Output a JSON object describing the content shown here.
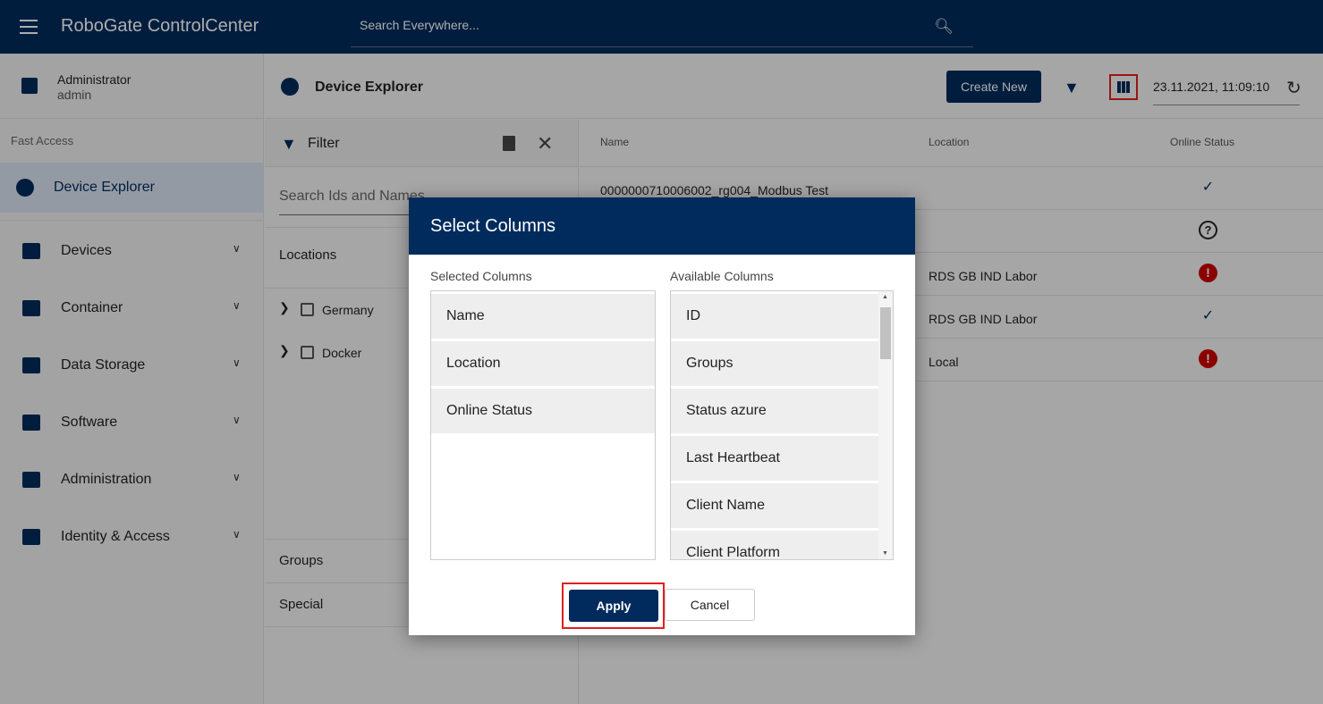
{
  "header": {
    "title": "RoboGate ControlCenter",
    "search_placeholder": "Search Everywhere..."
  },
  "sidebar": {
    "user_name": "Administrator",
    "user_login": "admin",
    "fast_access": "Fast Access",
    "active_item": "Device Explorer",
    "items": [
      {
        "label": "Devices"
      },
      {
        "label": "Container"
      },
      {
        "label": "Data Storage"
      },
      {
        "label": "Software"
      },
      {
        "label": "Administration"
      },
      {
        "label": "Identity & Access"
      }
    ]
  },
  "content": {
    "title": "Device Explorer",
    "create_new": "Create New",
    "timestamp": "23.11.2021, 11:09:10"
  },
  "filter": {
    "title": "Filter",
    "search_placeholder": "Search Ids and Names",
    "locations_label": "Locations",
    "locations": [
      {
        "label": "Germany"
      },
      {
        "label": "Docker"
      }
    ],
    "groups_label": "Groups",
    "special_label": "Special"
  },
  "table": {
    "headers": [
      "Name",
      "Location",
      "Online Status"
    ],
    "rows": [
      {
        "name": "0000000710006002_rg004_Modbus Test",
        "location": "",
        "status": "online"
      },
      {
        "name": "",
        "location": "",
        "status": "unknown"
      },
      {
        "name": "",
        "location": "RDS GB IND Labor",
        "status": "error"
      },
      {
        "name": "",
        "location": "RDS GB IND Labor",
        "status": "online"
      },
      {
        "name": "",
        "location": "Local",
        "status": "error"
      }
    ]
  },
  "dialog": {
    "title": "Select Columns",
    "selected_label": "Selected Columns",
    "available_label": "Available Columns",
    "selected": [
      "Name",
      "Location",
      "Online Status"
    ],
    "available": [
      "ID",
      "Groups",
      "Status azure",
      "Last Heartbeat",
      "Client Name",
      "Client Platform"
    ],
    "apply": "Apply",
    "cancel": "Cancel"
  },
  "colors": {
    "primary": "#002b5c",
    "error": "#cc0000",
    "highlight": "#e02020"
  }
}
